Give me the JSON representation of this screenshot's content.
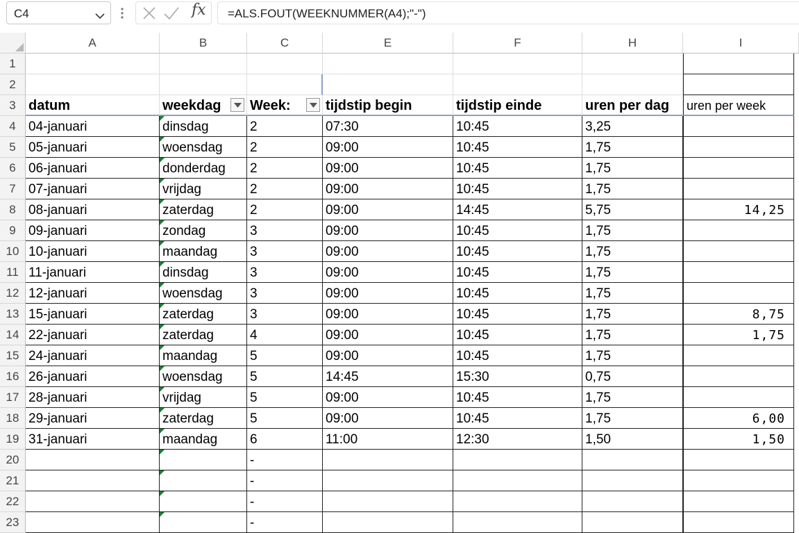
{
  "formula_bar": {
    "name_box": "C4",
    "formula": "=ALS.FOUT(WEEKNUMMER(A4);\"-\")"
  },
  "columns": [
    "A",
    "B",
    "C",
    "E",
    "F",
    "H",
    "I"
  ],
  "headers": {
    "datum": "datum",
    "weekdag": "weekdag",
    "week": "Week:",
    "begin": "tijdstip begin",
    "einde": "tijdstip einde",
    "uren_dag": "uren per dag",
    "uren_week": "uren per week"
  },
  "rows": [
    {
      "n": "4",
      "datum": "04-januari",
      "weekdag": "dinsdag",
      "week": "2",
      "begin": "07:30",
      "einde": "10:45",
      "uren_dag": "3,25",
      "uren_week": ""
    },
    {
      "n": "5",
      "datum": "05-januari",
      "weekdag": "woensdag",
      "week": "2",
      "begin": "09:00",
      "einde": "10:45",
      "uren_dag": "1,75",
      "uren_week": ""
    },
    {
      "n": "6",
      "datum": "06-januari",
      "weekdag": "donderdag",
      "week": "2",
      "begin": "09:00",
      "einde": "10:45",
      "uren_dag": "1,75",
      "uren_week": ""
    },
    {
      "n": "7",
      "datum": "07-januari",
      "weekdag": "vrijdag",
      "week": "2",
      "begin": "09:00",
      "einde": "10:45",
      "uren_dag": "1,75",
      "uren_week": ""
    },
    {
      "n": "8",
      "datum": "08-januari",
      "weekdag": "zaterdag",
      "week": "2",
      "begin": "09:00",
      "einde": "14:45",
      "uren_dag": "5,75",
      "uren_week": "14,25"
    },
    {
      "n": "9",
      "datum": "09-januari",
      "weekdag": "zondag",
      "week": "3",
      "begin": "09:00",
      "einde": "10:45",
      "uren_dag": "1,75",
      "uren_week": ""
    },
    {
      "n": "10",
      "datum": "10-januari",
      "weekdag": "maandag",
      "week": "3",
      "begin": "09:00",
      "einde": "10:45",
      "uren_dag": "1,75",
      "uren_week": ""
    },
    {
      "n": "11",
      "datum": "11-januari",
      "weekdag": "dinsdag",
      "week": "3",
      "begin": "09:00",
      "einde": "10:45",
      "uren_dag": "1,75",
      "uren_week": ""
    },
    {
      "n": "12",
      "datum": "12-januari",
      "weekdag": "woensdag",
      "week": "3",
      "begin": "09:00",
      "einde": "10:45",
      "uren_dag": "1,75",
      "uren_week": ""
    },
    {
      "n": "13",
      "datum": "15-januari",
      "weekdag": "zaterdag",
      "week": "3",
      "begin": "09:00",
      "einde": "10:45",
      "uren_dag": "1,75",
      "uren_week": "8,75"
    },
    {
      "n": "14",
      "datum": "22-januari",
      "weekdag": "zaterdag",
      "week": "4",
      "begin": "09:00",
      "einde": "10:45",
      "uren_dag": "1,75",
      "uren_week": "1,75"
    },
    {
      "n": "15",
      "datum": "24-januari",
      "weekdag": "maandag",
      "week": "5",
      "begin": "09:00",
      "einde": "10:45",
      "uren_dag": "1,75",
      "uren_week": ""
    },
    {
      "n": "16",
      "datum": "26-januari",
      "weekdag": "woensdag",
      "week": "5",
      "begin": "14:45",
      "einde": "15:30",
      "uren_dag": "0,75",
      "uren_week": ""
    },
    {
      "n": "17",
      "datum": "28-januari",
      "weekdag": "vrijdag",
      "week": "5",
      "begin": "09:00",
      "einde": "10:45",
      "uren_dag": "1,75",
      "uren_week": ""
    },
    {
      "n": "18",
      "datum": "29-januari",
      "weekdag": "zaterdag",
      "week": "5",
      "begin": "09:00",
      "einde": "10:45",
      "uren_dag": "1,75",
      "uren_week": "6,00"
    },
    {
      "n": "19",
      "datum": "31-januari",
      "weekdag": "maandag",
      "week": "6",
      "begin": "11:00",
      "einde": "12:30",
      "uren_dag": "1,50",
      "uren_week": "1,50"
    },
    {
      "n": "20",
      "datum": "",
      "weekdag": "",
      "week": "-",
      "begin": "",
      "einde": "",
      "uren_dag": "",
      "uren_week": ""
    },
    {
      "n": "21",
      "datum": "",
      "weekdag": "",
      "week": "-",
      "begin": "",
      "einde": "",
      "uren_dag": "",
      "uren_week": ""
    },
    {
      "n": "22",
      "datum": "",
      "weekdag": "",
      "week": "-",
      "begin": "",
      "einde": "",
      "uren_dag": "",
      "uren_week": ""
    },
    {
      "n": "23",
      "datum": "",
      "weekdag": "",
      "week": "-",
      "begin": "",
      "einde": "",
      "uren_dag": "",
      "uren_week": ""
    }
  ],
  "top_rows": [
    "1",
    "2",
    "3"
  ],
  "icons": [
    "chevron-down-icon",
    "kebab-icon",
    "cancel-icon",
    "enter-icon",
    "fx-icon",
    "filter-dropdown-icon",
    "select-all-icon"
  ]
}
